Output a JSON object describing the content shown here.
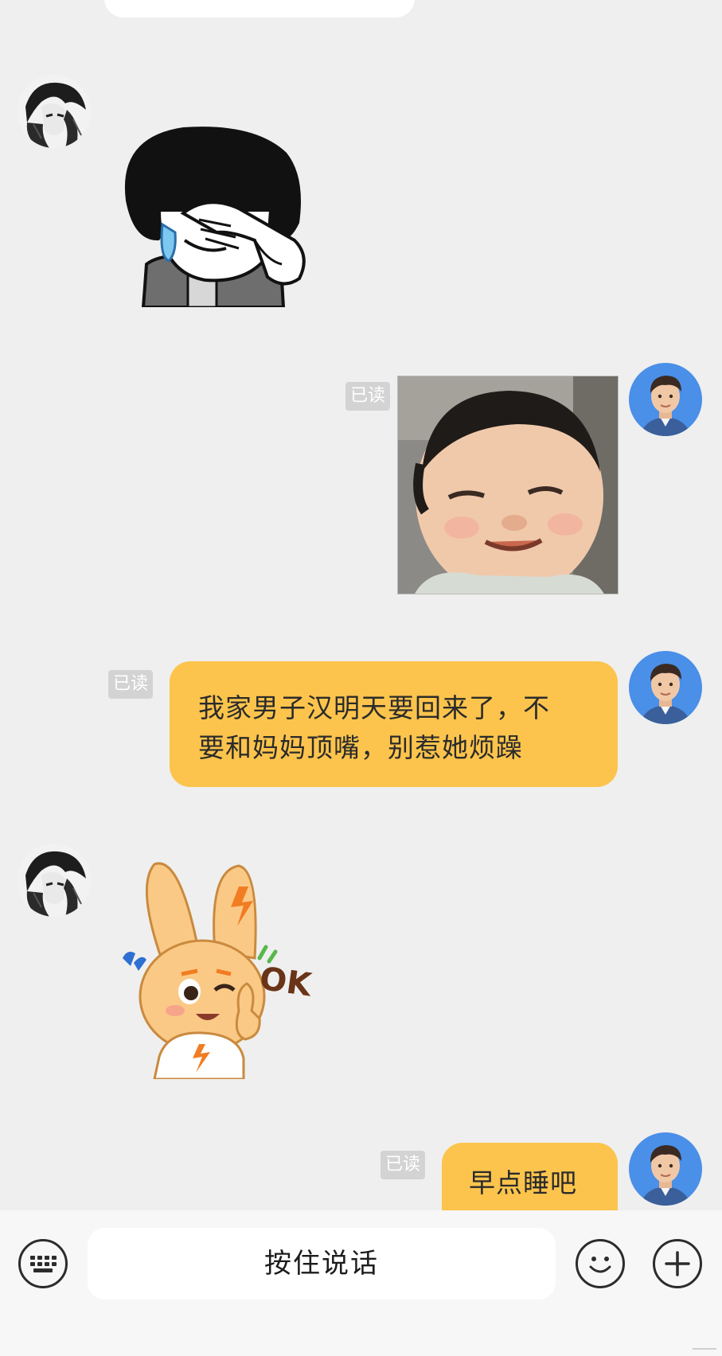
{
  "messages": [
    {
      "side": "left",
      "kind": "sticker",
      "sticker": "covering-eyes-crying-sticker"
    },
    {
      "side": "right",
      "kind": "image",
      "image": "smirking-baby-photo",
      "status": "已读"
    },
    {
      "side": "right",
      "kind": "text",
      "text_line1": "我家男子汉明天要回来了，不",
      "text_line2": "要和妈妈顶嘴，别惹她烦躁",
      "status": "已读"
    },
    {
      "side": "left",
      "kind": "sticker",
      "sticker": "bunny-ok-sticker",
      "sticker_text": "OK"
    },
    {
      "side": "right",
      "kind": "text",
      "text": "早点睡吧",
      "status": "已读"
    }
  ],
  "input_bar": {
    "voice_label": "按住说话",
    "left_icon": "keyboard-icon",
    "right_icons": [
      "emoji-icon",
      "plus-icon"
    ]
  },
  "colors": {
    "background": "#efefef",
    "my_bubble": "#fcc44c",
    "read_badge": "#d3d3d3",
    "bottom_bar": "#f7f7f7"
  }
}
